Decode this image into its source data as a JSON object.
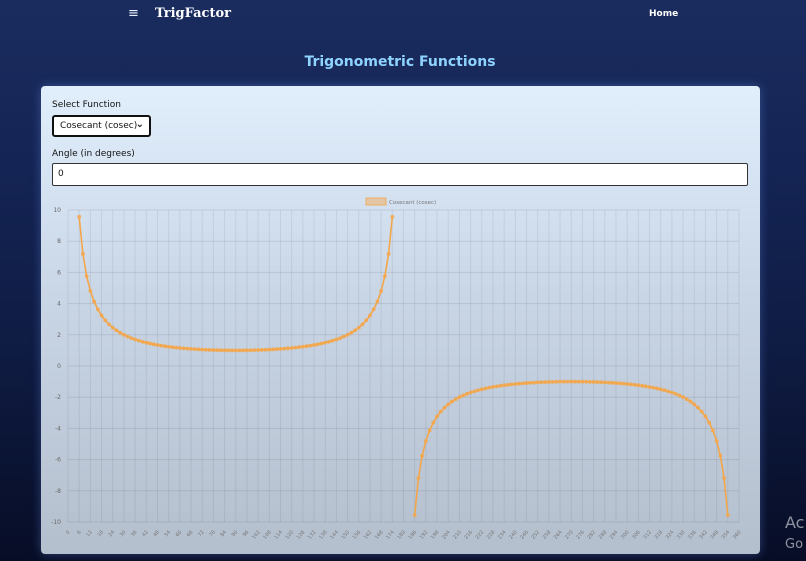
{
  "nav": {
    "brand": "TrigFactor",
    "menu_icon": "≡",
    "home": "Home"
  },
  "page_title": "Trigonometric Functions",
  "form": {
    "select_label": "Select Function",
    "selected_function": "Cosecant (cosec)",
    "angle_label": "Angle (in degrees)",
    "angle_value": "0"
  },
  "watermark": {
    "line1": "Ac",
    "line2": "Go"
  },
  "colors": {
    "accent": "#f4a64a",
    "title": "#8fd3ff"
  },
  "chart_data": {
    "type": "line",
    "function": "cosec",
    "series": [
      {
        "name": "Cosecant (cosec)",
        "color": "#f4a64a"
      }
    ],
    "x_range": [
      0,
      360
    ],
    "x_step": 2,
    "ylim": [
      -10,
      10
    ],
    "yticks": [
      -10,
      -8,
      -6,
      -4,
      -2,
      0,
      2,
      4,
      6,
      8,
      10
    ],
    "grid": true,
    "legend_position": "top-center"
  }
}
